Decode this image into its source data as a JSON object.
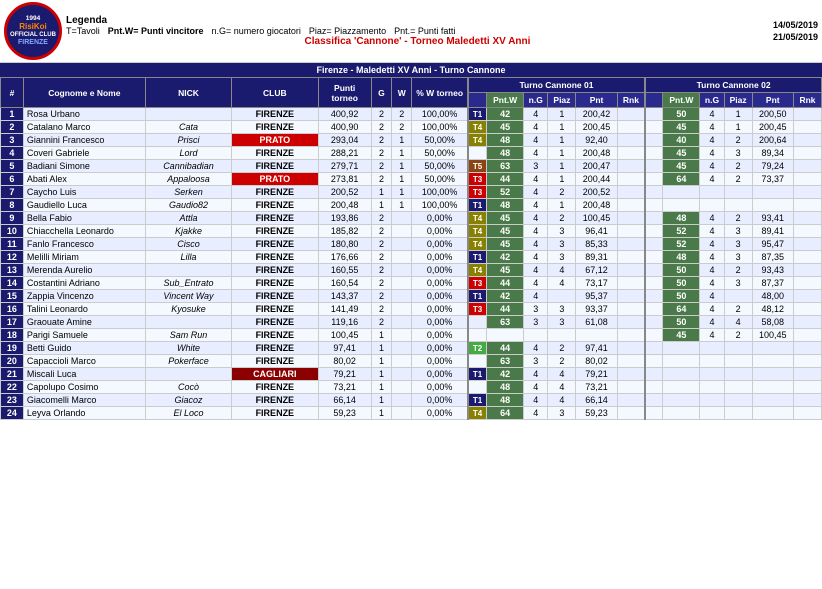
{
  "legend": {
    "title": "Legenda",
    "items": [
      {
        "key": "T=Tavoli"
      },
      {
        "key": "Pnt.W= Punti vincitore"
      },
      {
        "key": "n.G= numero giocatori"
      },
      {
        "key": "Piaz= Piazzamento"
      },
      {
        "key": "Pnt.= Punti fatti"
      }
    ]
  },
  "dates": {
    "start": "14/05/2019",
    "end": "21/05/2019"
  },
  "title": "Classifica 'Cannone' - Torneo Maledetti XV Anni",
  "subtitle": "Firenze - Maledetti XV Anni - Turno Cannone",
  "turno1": "Turno Cannone 01",
  "turno2": "Turno Cannone 02",
  "columns": {
    "pos": "#",
    "cognome": "Cognome e Nome",
    "nick": "NICK",
    "club": "CLUB",
    "punti": "Punti torneo",
    "g": "G",
    "w": "W",
    "ptorneo": "% W torneo",
    "pntw": "Pnt.W",
    "ng": "n.G",
    "piaz": "Piaz",
    "pnt": "Pnt",
    "rnk": "Rnk"
  },
  "rows": [
    {
      "pos": 1,
      "cognome": "Rosa Urbano",
      "nick": "",
      "club": "FIRENZE",
      "punti": "400,92",
      "g": 2,
      "w": 2,
      "ptorneo": "100,00%",
      "tag": "T1",
      "tc1": {
        "pntw": 42,
        "ng": 4,
        "piaz": 1,
        "pnt": 42,
        "rnk": ""
      },
      "tc1pnt": "200,42",
      "tc1rnk": "",
      "tc2": {
        "pntw": 50,
        "ng": 4,
        "piaz": 1,
        "pnt": 50,
        "rnk": ""
      },
      "tc2pnt": "200,50",
      "tc2rnk": ""
    },
    {
      "pos": 2,
      "cognome": "Catalano Marco",
      "nick": "Cata",
      "club": "FIRENZE",
      "punti": "400,90",
      "g": 2,
      "w": 2,
      "ptorneo": "100,00%",
      "tag": "T4",
      "tc1": {
        "pntw": 45,
        "ng": 4,
        "piaz": 1,
        "pnt": 45,
        "rnk": ""
      },
      "tc1pnt": "200,45",
      "tc1rnk": "",
      "tc2": {
        "pntw": 45,
        "ng": 4,
        "piaz": 1,
        "pnt": 45,
        "rnk": ""
      },
      "tc2pnt": "200,45",
      "tc2rnk": ""
    },
    {
      "pos": 3,
      "cognome": "Giannini Francesco",
      "nick": "Prisci",
      "club": "PRATO",
      "punti": "293,04",
      "g": 2,
      "w": 1,
      "ptorneo": "50,00%",
      "tag": "T4",
      "tc1": {
        "pntw": 48,
        "ng": 4,
        "piaz": 1,
        "pnt": 48,
        "rnk": ""
      },
      "tc1pnt": "92,40",
      "tc1rnk": "",
      "tc2": {
        "pntw": 40,
        "ng": 4,
        "piaz": 2,
        "pnt": 40,
        "rnk": ""
      },
      "tc2pnt": "200,64",
      "tc2rnk": ""
    },
    {
      "pos": 4,
      "cognome": "Coveri Gabriele",
      "nick": "Lord",
      "club": "FIRENZE",
      "punti": "288,21",
      "g": 2,
      "w": 1,
      "ptorneo": "50,00%",
      "tag": "",
      "tc1": {
        "pntw": 48,
        "ng": 4,
        "piaz": 1,
        "pnt": 48,
        "rnk": ""
      },
      "tc1pnt": "200,48",
      "tc1rnk": "",
      "tc2": {
        "pntw": 45,
        "ng": 4,
        "piaz": 3,
        "pnt": 34,
        "rnk": ""
      },
      "tc2pnt": "89,34",
      "tc2rnk": ""
    },
    {
      "pos": 5,
      "cognome": "Badiani Simone",
      "nick": "Cannibadian",
      "club": "FIRENZE",
      "punti": "279,71",
      "g": 2,
      "w": 1,
      "ptorneo": "50,00%",
      "tag": "T5",
      "tc1": {
        "pntw": 63,
        "ng": 3,
        "piaz": 1,
        "pnt": 63,
        "rnk": ""
      },
      "tc1pnt": "200,47",
      "tc1rnk": "",
      "tc2": {
        "pntw": 45,
        "ng": 4,
        "piaz": 2,
        "pnt": 24,
        "rnk": ""
      },
      "tc2pnt": "79,24",
      "tc2rnk": ""
    },
    {
      "pos": 6,
      "cognome": "Abati Alex",
      "nick": "Appaloosa",
      "club": "PRATO",
      "punti": "273,81",
      "g": 2,
      "w": 1,
      "ptorneo": "50,00%",
      "tag": "T3",
      "tc1": {
        "pntw": 44,
        "ng": 4,
        "piaz": 1,
        "pnt": 44,
        "rnk": ""
      },
      "tc1pnt": "200,44",
      "tc1rnk": "",
      "tc2": {
        "pntw": 64,
        "ng": 4,
        "piaz": 2,
        "pnt": 37,
        "rnk": ""
      },
      "tc2pnt": "73,37",
      "tc2rnk": ""
    },
    {
      "pos": 7,
      "cognome": "Caycho Luis",
      "nick": "Serken",
      "club": "FIRENZE",
      "punti": "200,52",
      "g": 1,
      "w": 1,
      "ptorneo": "100,00%",
      "tag": "T3",
      "tc1": {
        "pntw": 52,
        "ng": 4,
        "piaz": 2,
        "pnt": 52,
        "rnk": ""
      },
      "tc1pnt": "200,52",
      "tc1rnk": "",
      "tc2": null,
      "tc2pnt": "",
      "tc2rnk": ""
    },
    {
      "pos": 8,
      "cognome": "Gaudiello Luca",
      "nick": "Gaudio82",
      "club": "FIRENZE",
      "punti": "200,48",
      "g": 1,
      "w": 1,
      "ptorneo": "100,00%",
      "tag": "T1",
      "tc1": {
        "pntw": 48,
        "ng": 4,
        "piaz": 1,
        "pnt": 48,
        "rnk": ""
      },
      "tc1pnt": "200,48",
      "tc1rnk": "",
      "tc2": null,
      "tc2pnt": "",
      "tc2rnk": ""
    },
    {
      "pos": 9,
      "cognome": "Bella Fabio",
      "nick": "Attla",
      "club": "FIRENZE",
      "punti": "193,86",
      "g": 2,
      "w": 0,
      "ptorneo": "0,00%",
      "tag": "T4",
      "tc1": {
        "pntw": 45,
        "ng": 4,
        "piaz": 2,
        "pnt": 45,
        "rnk": ""
      },
      "tc1pnt": "100,45",
      "tc1rnk": "",
      "tc2": {
        "pntw": 48,
        "ng": 4,
        "piaz": 2,
        "pnt": 41,
        "rnk": ""
      },
      "tc2pnt": "93,41",
      "tc2rnk": ""
    },
    {
      "pos": 10,
      "cognome": "Chiacchella Leonardo",
      "nick": "Kjakke",
      "club": "FIRENZE",
      "punti": "185,82",
      "g": 2,
      "w": 0,
      "ptorneo": "0,00%",
      "tag": "T4",
      "tc1": {
        "pntw": 45,
        "ng": 4,
        "piaz": 3,
        "pnt": 41,
        "rnk": ""
      },
      "tc1pnt": "96,41",
      "tc1rnk": "",
      "tc2": {
        "pntw": 52,
        "ng": 4,
        "piaz": 3,
        "pnt": 41,
        "rnk": ""
      },
      "tc2pnt": "89,41",
      "tc2rnk": ""
    },
    {
      "pos": 11,
      "cognome": "Fanlo Francesco",
      "nick": "Cisco",
      "club": "FIRENZE",
      "punti": "180,80",
      "g": 2,
      "w": 0,
      "ptorneo": "0,00%",
      "tag": "T4",
      "tc1": {
        "pntw": 45,
        "ng": 4,
        "piaz": 3,
        "pnt": 45,
        "rnk": ""
      },
      "tc1pnt": "85,33",
      "tc1rnk": "",
      "tc2": {
        "pntw": 52,
        "ng": 4,
        "piaz": 3,
        "pnt": 45,
        "rnk": ""
      },
      "tc2pnt": "95,47",
      "tc2rnk": ""
    },
    {
      "pos": 12,
      "cognome": "Melilli Miriam",
      "nick": "Lilla",
      "club": "FIRENZE",
      "punti": "176,66",
      "g": 2,
      "w": 0,
      "ptorneo": "0,00%",
      "tag": "T1",
      "tc1": {
        "pntw": 42,
        "ng": 4,
        "piaz": 3,
        "pnt": 31,
        "rnk": ""
      },
      "tc1pnt": "89,31",
      "tc1rnk": "",
      "tc2": {
        "pntw": 48,
        "ng": 4,
        "piaz": 3,
        "pnt": 35,
        "rnk": ""
      },
      "tc2pnt": "87,35",
      "tc2rnk": ""
    },
    {
      "pos": 13,
      "cognome": "Merenda Aurelio",
      "nick": "",
      "club": "FIRENZE",
      "punti": "160,55",
      "g": 2,
      "w": 0,
      "ptorneo": "0,00%",
      "tag": "T4",
      "tc1": {
        "pntw": 45,
        "ng": 4,
        "piaz": 4,
        "pnt": 12,
        "rnk": ""
      },
      "tc1pnt": "67,12",
      "tc1rnk": "",
      "tc2": {
        "pntw": 50,
        "ng": 4,
        "piaz": 2,
        "pnt": 43,
        "rnk": ""
      },
      "tc2pnt": "93,43",
      "tc2rnk": ""
    },
    {
      "pos": 14,
      "cognome": "Costantini Adriano",
      "nick": "Sub_Entrato",
      "club": "FIRENZE",
      "punti": "160,54",
      "g": 2,
      "w": 0,
      "ptorneo": "0,00%",
      "tag": "T3",
      "tc1": {
        "pntw": 44,
        "ng": 4,
        "piaz": 4,
        "pnt": 17,
        "rnk": ""
      },
      "tc1pnt": "73,17",
      "tc1rnk": "",
      "tc2": {
        "pntw": 50,
        "ng": 4,
        "piaz": 3,
        "pnt": 37,
        "rnk": ""
      },
      "tc2pnt": "87,37",
      "tc2rnk": ""
    },
    {
      "pos": 15,
      "cognome": "Zappia Vincenzo",
      "nick": "Vincent Way",
      "club": "FIRENZE",
      "punti": "143,37",
      "g": 2,
      "w": 0,
      "ptorneo": "0,00%",
      "tag": "T1",
      "tc1": {
        "pntw": 42,
        "ng": 4,
        "piaz": "",
        "pnt": "",
        "rnk": ""
      },
      "tc1pnt": "95,37",
      "tc1rnk": "",
      "tc2": {
        "pntw": 50,
        "ng": 4,
        "piaz": "",
        "pnt": "",
        "rnk": ""
      },
      "tc2pnt": "48,00",
      "tc2rnk": ""
    },
    {
      "pos": 16,
      "cognome": "Talini Leonardo",
      "nick": "Kyosuke",
      "club": "FIRENZE",
      "punti": "141,49",
      "g": 2,
      "w": 0,
      "ptorneo": "0,00%",
      "tag": "T3",
      "tc1": {
        "pntw": 44,
        "ng": 3,
        "piaz": 3,
        "pnt": 37,
        "rnk": ""
      },
      "tc1pnt": "93,37",
      "tc1rnk": "",
      "tc2": {
        "pntw": 64,
        "ng": 4,
        "piaz": 2,
        "pnt": 23,
        "rnk": ""
      },
      "tc2pnt": "48,12",
      "tc2rnk": ""
    },
    {
      "pos": 17,
      "cognome": "Graouate Amine",
      "nick": "",
      "club": "FIRENZE",
      "punti": "119,16",
      "g": 2,
      "w": 0,
      "ptorneo": "0,00%",
      "tag": "",
      "tc1": {
        "pntw": 63,
        "ng": 3,
        "piaz": 3,
        "pnt": 11,
        "rnk": ""
      },
      "tc1pnt": "61,08",
      "tc1rnk": "",
      "tc2": {
        "pntw": 50,
        "ng": 4,
        "piaz": 4,
        "pnt": 8,
        "rnk": ""
      },
      "tc2pnt": "58,08",
      "tc2rnk": ""
    },
    {
      "pos": 18,
      "cognome": "Parigi Samuele",
      "nick": "Sam Run",
      "club": "FIRENZE",
      "punti": "100,45",
      "g": 1,
      "w": 0,
      "ptorneo": "0,00%",
      "tag": "",
      "tc1": null,
      "tc1pnt": "",
      "tc1rnk": "",
      "tc2": {
        "pntw": 45,
        "ng": 4,
        "piaz": 2,
        "pnt": 45,
        "rnk": ""
      },
      "tc2pnt": "100,45",
      "tc2rnk": ""
    },
    {
      "pos": 19,
      "cognome": "Betti Guido",
      "nick": "White",
      "club": "FIRENZE",
      "punti": "97,41",
      "g": 1,
      "w": 0,
      "ptorneo": "0,00%",
      "tag": "T2",
      "tc1": {
        "pntw": 44,
        "ng": 4,
        "piaz": 2,
        "pnt": 41,
        "rnk": ""
      },
      "tc1pnt": "97,41",
      "tc1rnk": "",
      "tc2": null,
      "tc2pnt": "",
      "tc2rnk": ""
    },
    {
      "pos": 20,
      "cognome": "Capaccioli Marco",
      "nick": "Pokerface",
      "club": "FIRENZE",
      "punti": "80,02",
      "g": 1,
      "w": 0,
      "ptorneo": "0,00%",
      "tag": "",
      "tc1": {
        "pntw": 63,
        "ng": 3,
        "piaz": 2,
        "pnt": 36,
        "rnk": ""
      },
      "tc1pnt": "80,02",
      "tc1rnk": "",
      "tc2": null,
      "tc2pnt": "",
      "tc2rnk": ""
    },
    {
      "pos": 21,
      "cognome": "Miscali Luca",
      "nick": "",
      "club": "CAGLIARI",
      "punti": "79,21",
      "g": 1,
      "w": 0,
      "ptorneo": "0,00%",
      "tag": "T1",
      "tc1": {
        "pntw": 42,
        "ng": 4,
        "piaz": 4,
        "pnt": 21,
        "rnk": ""
      },
      "tc1pnt": "79,21",
      "tc1rnk": "",
      "tc2": null,
      "tc2pnt": "",
      "tc2rnk": ""
    },
    {
      "pos": 22,
      "cognome": "Capolupo Cosimo",
      "nick": "Cocò",
      "club": "FIRENZE",
      "punti": "73,21",
      "g": 1,
      "w": 0,
      "ptorneo": "0,00%",
      "tag": "",
      "tc1": {
        "pntw": 48,
        "ng": 4,
        "piaz": 4,
        "pnt": 21,
        "rnk": ""
      },
      "tc1pnt": "73,21",
      "tc1rnk": "",
      "tc2": null,
      "tc2pnt": "",
      "tc2rnk": ""
    },
    {
      "pos": 23,
      "cognome": "Giacomelli Marco",
      "nick": "Giacoz",
      "club": "FIRENZE",
      "punti": "66,14",
      "g": 1,
      "w": 0,
      "ptorneo": "0,00%",
      "tag": "T1",
      "tc1": {
        "pntw": 48,
        "ng": 4,
        "piaz": 4,
        "pnt": 14,
        "rnk": ""
      },
      "tc1pnt": "66,14",
      "tc1rnk": "",
      "tc2": null,
      "tc2pnt": "",
      "tc2rnk": ""
    },
    {
      "pos": 24,
      "cognome": "Leyva Orlando",
      "nick": "El Loco",
      "club": "FIRENZE",
      "punti": "59,23",
      "g": 1,
      "w": 0,
      "ptorneo": "0,00%",
      "tag": "T4",
      "tc1": {
        "pntw": 64,
        "ng": 4,
        "piaz": 3,
        "pnt": 23,
        "rnk": ""
      },
      "tc1pnt": "59,23",
      "tc1rnk": "",
      "tc2": null,
      "tc2pnt": "",
      "tc2rnk": ""
    }
  ]
}
